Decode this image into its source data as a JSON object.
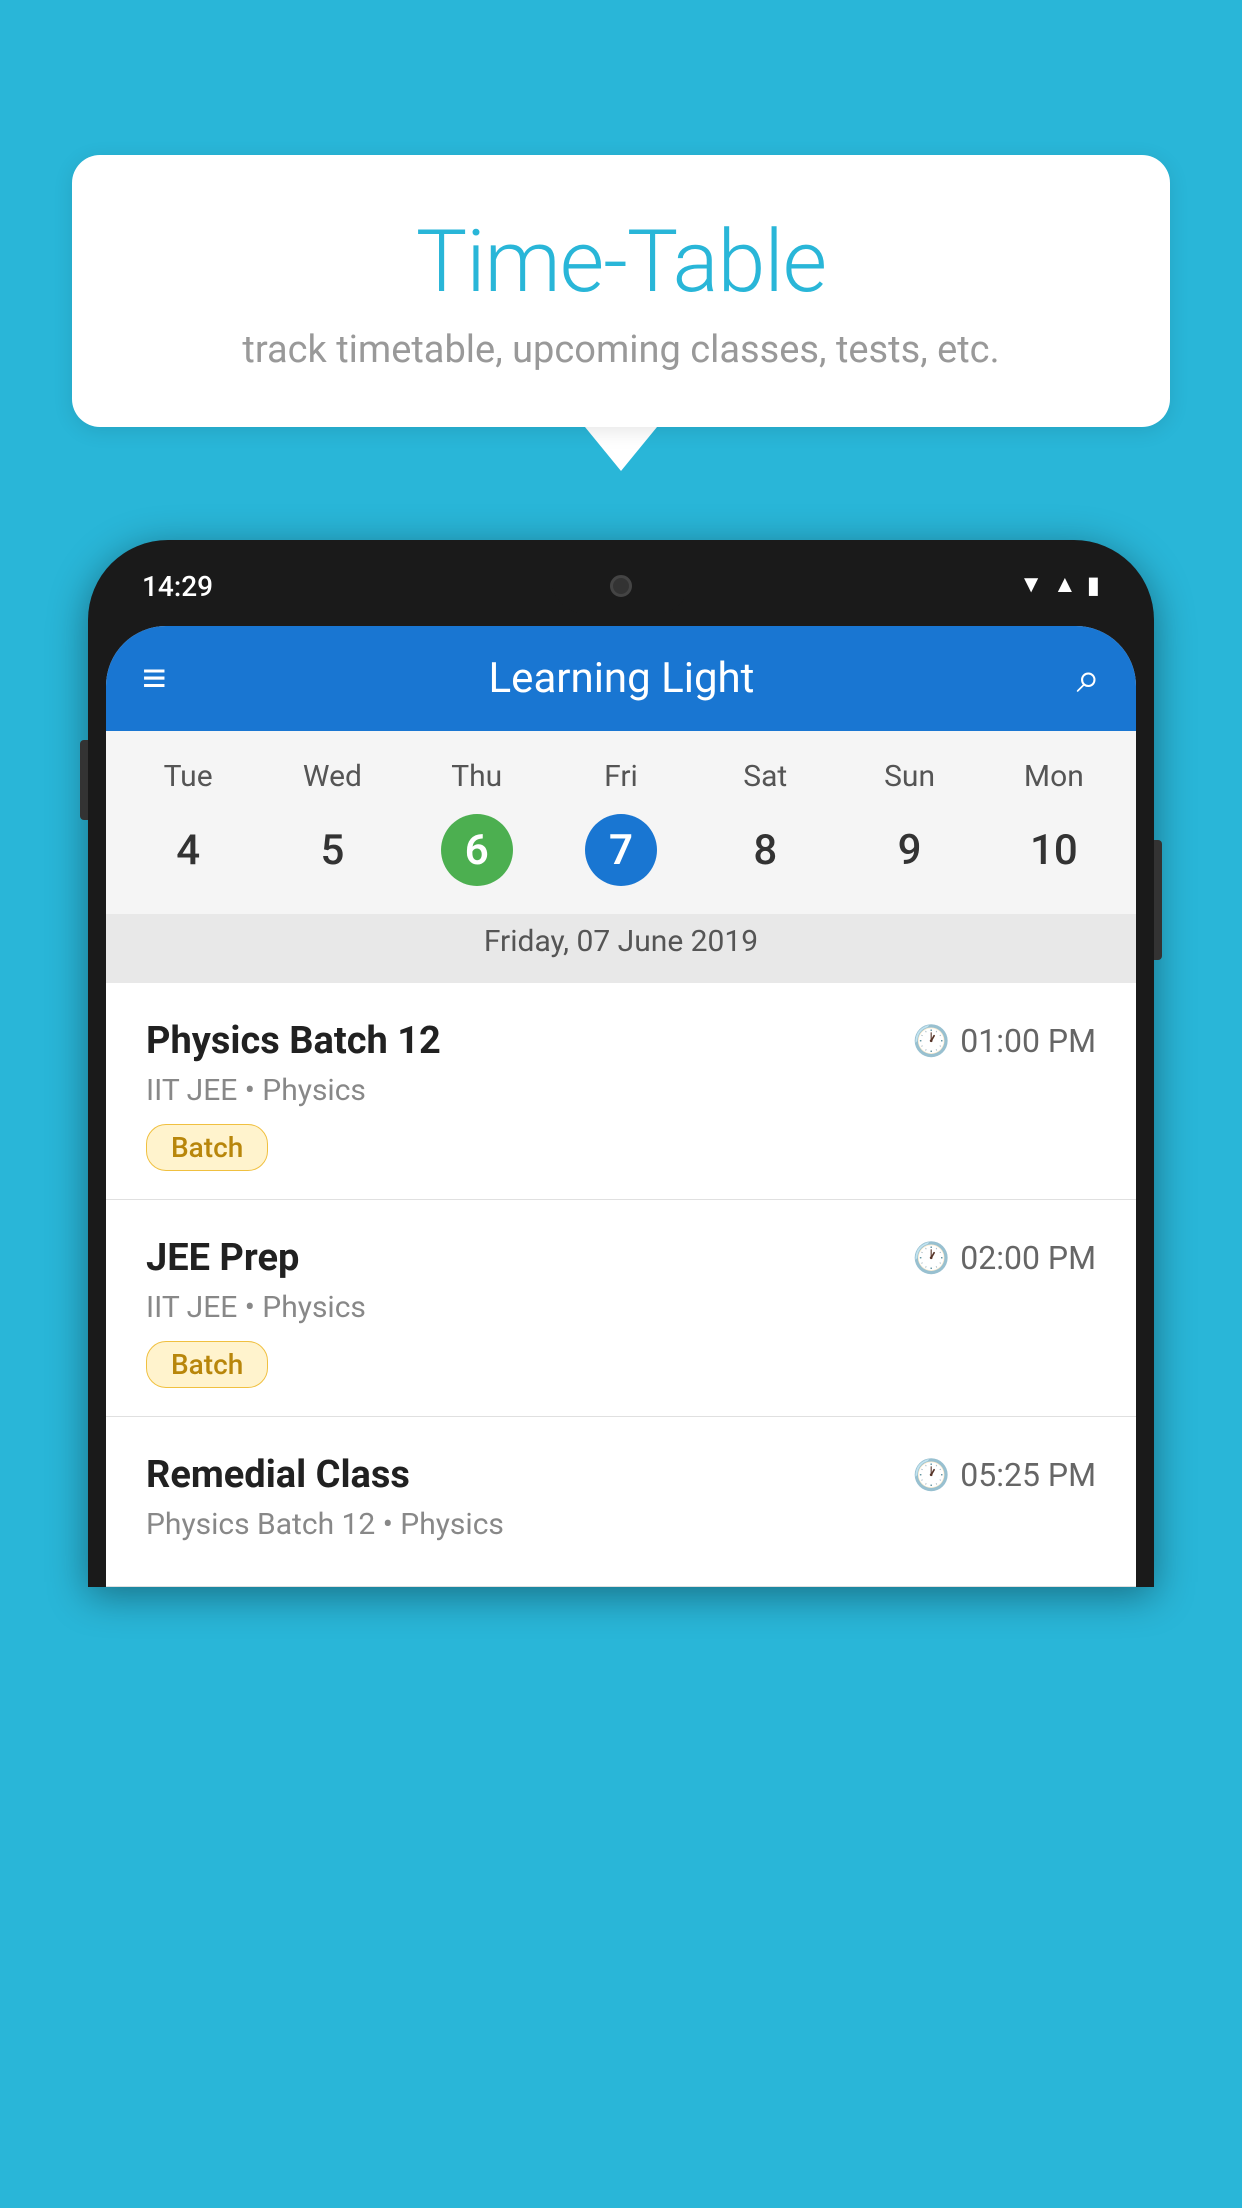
{
  "background_color": "#29b6d8",
  "speech_bubble": {
    "title": "Time-Table",
    "subtitle": "track timetable, upcoming classes, tests, etc."
  },
  "phone": {
    "status_bar": {
      "time": "14:29"
    },
    "app_bar": {
      "title": "Learning Light",
      "menu_icon": "≡",
      "search_icon": "🔍"
    },
    "calendar": {
      "days": [
        {
          "label": "Tue",
          "num": "4"
        },
        {
          "label": "Wed",
          "num": "5"
        },
        {
          "label": "Thu",
          "num": "6",
          "highlight": "green"
        },
        {
          "label": "Fri",
          "num": "7",
          "highlight": "blue"
        },
        {
          "label": "Sat",
          "num": "8"
        },
        {
          "label": "Sun",
          "num": "9"
        },
        {
          "label": "Mon",
          "num": "10"
        }
      ],
      "selected_date": "Friday, 07 June 2019"
    },
    "schedule": [
      {
        "title": "Physics Batch 12",
        "time": "01:00 PM",
        "subtitle": "IIT JEE • Physics",
        "badge": "Batch"
      },
      {
        "title": "JEE Prep",
        "time": "02:00 PM",
        "subtitle": "IIT JEE • Physics",
        "badge": "Batch"
      },
      {
        "title": "Remedial Class",
        "time": "05:25 PM",
        "subtitle": "Physics Batch 12 • Physics",
        "badge": null
      }
    ]
  }
}
